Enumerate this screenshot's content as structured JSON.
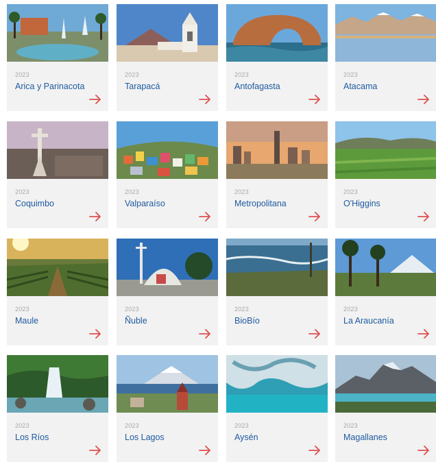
{
  "regions": [
    {
      "year": "2023",
      "name": "Arica y Parinacota",
      "image": "plaza-fountain-palms"
    },
    {
      "year": "2023",
      "name": "Tarapacá",
      "image": "white-church-volcano"
    },
    {
      "year": "2023",
      "name": "Antofagasta",
      "image": "rock-arch-sea"
    },
    {
      "year": "2023",
      "name": "Atacama",
      "image": "lagoon-snow-mountains"
    },
    {
      "year": "2023",
      "name": "Coquimbo",
      "image": "cross-monument-city"
    },
    {
      "year": "2023",
      "name": "Valparaíso",
      "image": "colorful-hillside-houses"
    },
    {
      "year": "2023",
      "name": "Metropolitana",
      "image": "city-skyline-sunset"
    },
    {
      "year": "2023",
      "name": "O'Higgins",
      "image": "green-valley-fields"
    },
    {
      "year": "2023",
      "name": "Maule",
      "image": "vineyard-sunset"
    },
    {
      "year": "2023",
      "name": "Ñuble",
      "image": "modern-cathedral-cross"
    },
    {
      "year": "2023",
      "name": "BioBío",
      "image": "coast-waves-cliffs"
    },
    {
      "year": "2023",
      "name": "La Araucanía",
      "image": "araucaria-trees-volcano"
    },
    {
      "year": "2023",
      "name": "Los Ríos",
      "image": "waterfall-forest"
    },
    {
      "year": "2023",
      "name": "Los Lagos",
      "image": "lake-town-volcano"
    },
    {
      "year": "2023",
      "name": "Aysén",
      "image": "marble-caves-turquoise"
    },
    {
      "year": "2023",
      "name": "Magallanes",
      "image": "torres-del-paine-lake"
    }
  ],
  "arrow_icon": "arrow-right-icon",
  "colors": {
    "accent": "#e04e4e",
    "title": "#1e5aa0",
    "year": "#a8a8a8",
    "card": "#f2f2f2"
  }
}
